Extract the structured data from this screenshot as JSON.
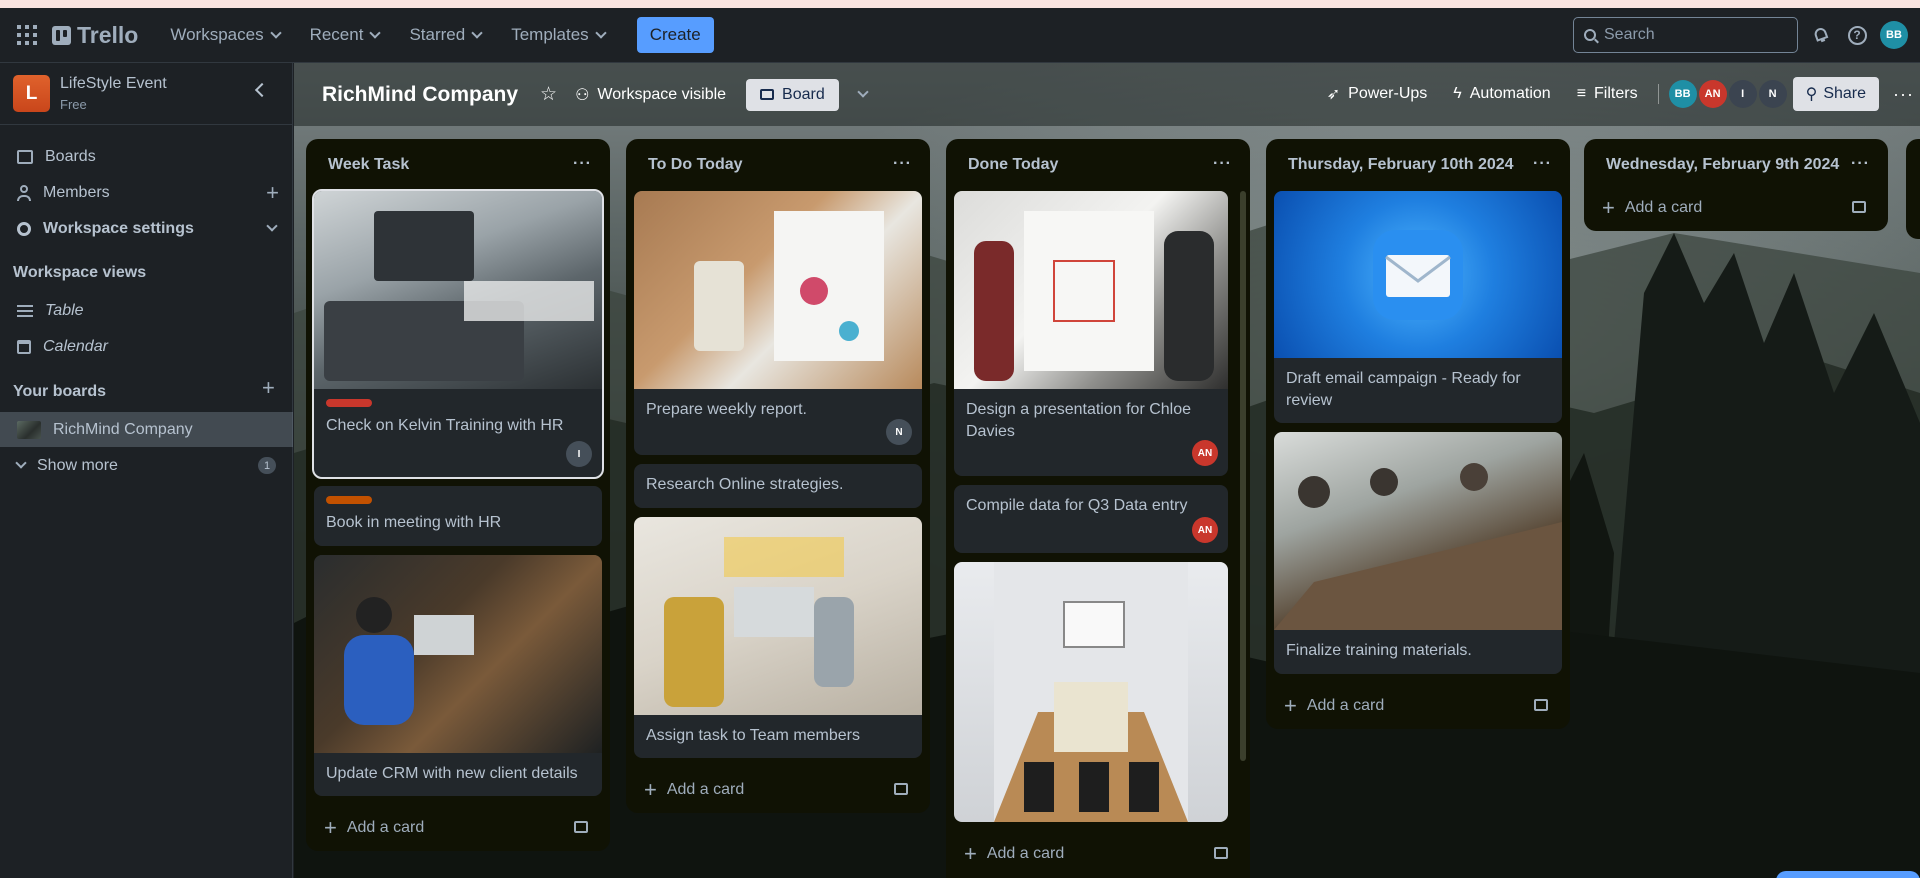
{
  "topnav": {
    "logo": "Trello",
    "menu": [
      {
        "label": "Workspaces"
      },
      {
        "label": "Recent"
      },
      {
        "label": "Starred"
      },
      {
        "label": "Templates"
      }
    ],
    "create_label": "Create",
    "search_placeholder": "Search",
    "user_initials": "BB"
  },
  "sidebar": {
    "workspace_initial": "L",
    "workspace_name": "LifeStyle Event",
    "workspace_plan": "Free",
    "items": [
      {
        "label": "Boards"
      },
      {
        "label": "Members"
      },
      {
        "label": "Workspace settings"
      }
    ],
    "views_heading": "Workspace views",
    "views": [
      {
        "label": "Table"
      },
      {
        "label": "Calendar"
      }
    ],
    "boards_heading": "Your boards",
    "boards": [
      {
        "label": "RichMind Company"
      }
    ],
    "show_more_label": "Show more",
    "show_more_count": "1"
  },
  "board_header": {
    "title": "RichMind Company",
    "visibility": "Workspace visible",
    "view": "Board",
    "powerups": "Power-Ups",
    "automation": "Automation",
    "filters": "Filters",
    "members": [
      {
        "initials": "BB",
        "color": "#1f8fa5"
      },
      {
        "initials": "AN",
        "color": "#c9372c"
      },
      {
        "initials": "I",
        "color": "#3b4450"
      },
      {
        "initials": "N",
        "color": "#3b4450"
      }
    ],
    "share": "Share"
  },
  "lists": [
    {
      "title": "Week Task",
      "cards": [
        {
          "title": "Check on Kelvin Training with HR",
          "label_color": "#c9372c",
          "avatar": "I",
          "cover": "laptop"
        },
        {
          "title": "Book in meeting with HR",
          "label_color": "#c25100"
        },
        {
          "title": "Update CRM with new client details",
          "cover": "desk"
        }
      ],
      "add_label": "Add a card"
    },
    {
      "title": "To Do Today",
      "cards": [
        {
          "title": "Prepare weekly report.",
          "avatar": "N",
          "cover": "charts"
        },
        {
          "title": "Research Online strategies."
        },
        {
          "title": "Assign task to Team members",
          "cover": "team"
        }
      ],
      "add_label": "Add a card"
    },
    {
      "title": "Done Today",
      "cards": [
        {
          "title": "Design a presentation for Chloe Davies",
          "avatar": "AN",
          "cover": "whiteboard"
        },
        {
          "title": "Compile data for Q3 Data entry",
          "avatar": "AN"
        },
        {
          "cover": "conference"
        }
      ],
      "add_label": "Add a card"
    },
    {
      "title": "Thursday, February 10th 2024",
      "cards": [
        {
          "title": "Draft email campaign - Ready for review",
          "cover": "email"
        },
        {
          "title": "Finalize training materials.",
          "cover": "meeting"
        }
      ],
      "add_label": "Add a card"
    },
    {
      "title": "Wednesday, February 9th 2024",
      "cards": [],
      "add_label": "Add a card"
    }
  ]
}
